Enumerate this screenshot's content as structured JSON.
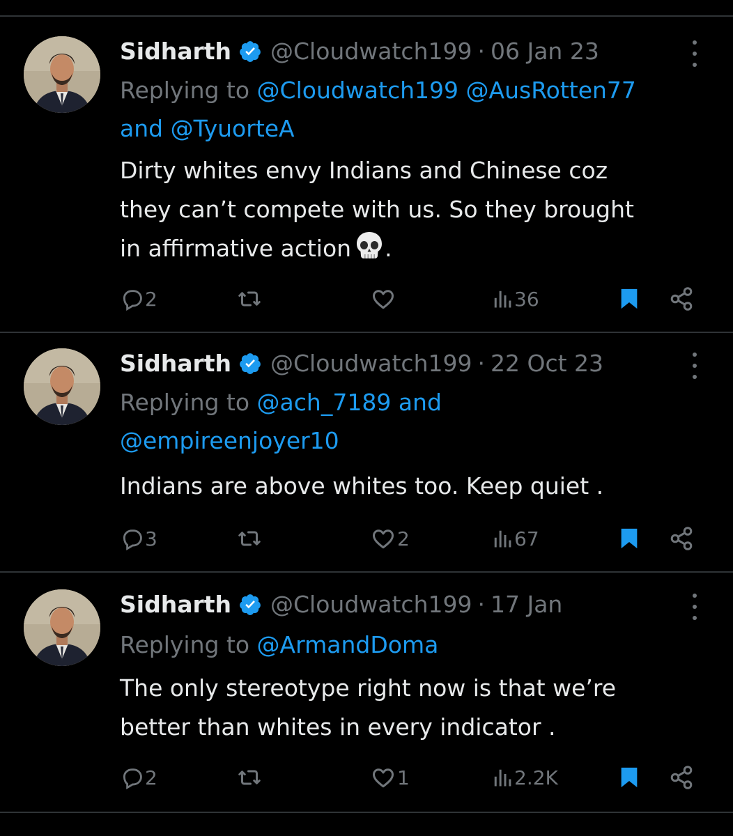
{
  "colors": {
    "background": "#000000",
    "text_primary": "#e7e9ea",
    "text_secondary": "#71767b",
    "accent": "#1d9bf0",
    "divider": "#2f3336"
  },
  "tweets": [
    {
      "author": "Sidharth",
      "handle": "@Cloudwatch199",
      "separator": "·",
      "date": "06 Jan 23",
      "replying_prefix": "Replying to",
      "mentions": [
        "@Cloudwatch199",
        "@AusRotten77",
        "@TyuorteA"
      ],
      "conjunction": "and",
      "text_lines": [
        "Dirty whites envy Indians and Chinese coz",
        "they can’t compete with us. So they brought",
        "in affirmative action"
      ],
      "text_trailing": ".",
      "emoji_icon": "skull-icon",
      "replies": "2",
      "reposts": "",
      "likes": "",
      "views": "36",
      "bookmarked": true
    },
    {
      "author": "Sidharth",
      "handle": "@Cloudwatch199",
      "separator": "·",
      "date": "22 Oct 23",
      "replying_prefix": "Replying to",
      "mentions": [
        "@ach_7189",
        "@empireenjoyer10"
      ],
      "conjunction": "and",
      "text_lines": [
        "Indians are above whites too. Keep quiet ."
      ],
      "replies": "3",
      "reposts": "",
      "likes": "2",
      "views": "67",
      "bookmarked": true
    },
    {
      "author": "Sidharth",
      "handle": "@Cloudwatch199",
      "separator": "·",
      "date": "17 Jan",
      "replying_prefix": "Replying to",
      "mentions": [
        "@ArmandDoma"
      ],
      "text_lines": [
        "The only stereotype right now is that we’re",
        "better than whites in every indicator ."
      ],
      "replies": "2",
      "reposts": "",
      "likes": "1",
      "views": "2.2K",
      "bookmarked": true
    }
  ],
  "icons": {
    "reply": "reply-icon",
    "repost": "repost-icon",
    "like": "heart-icon",
    "views": "views-chart-icon",
    "bookmark": "bookmark-icon",
    "share": "share-icon",
    "more": "more-options-icon",
    "verified": "verified-badge-icon"
  }
}
